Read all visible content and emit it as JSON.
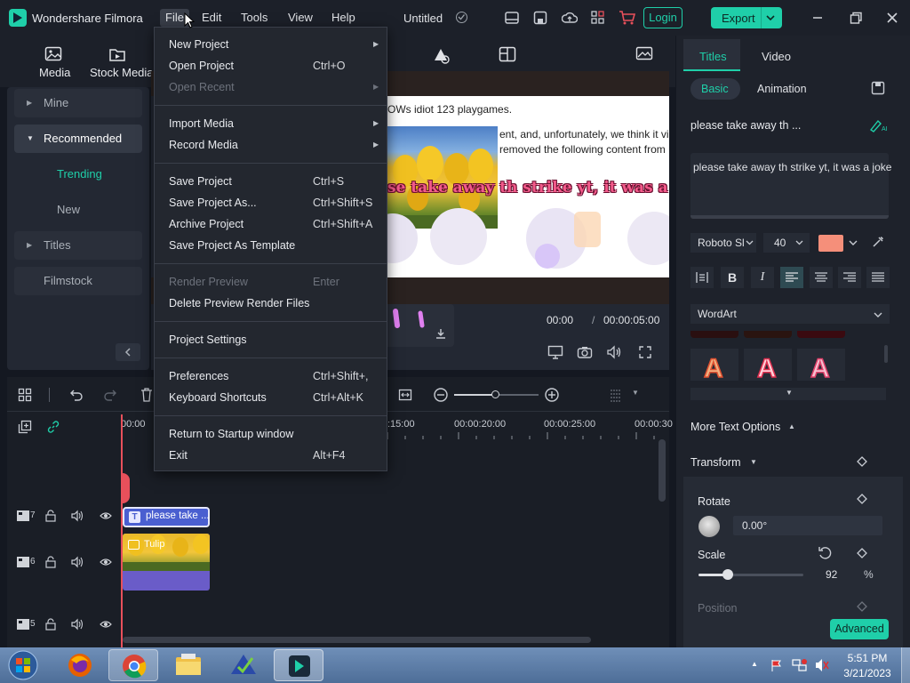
{
  "app": {
    "name": "Wondershare Filmora",
    "doc_title": "Untitled"
  },
  "menubar": [
    "File",
    "Edit",
    "Tools",
    "View",
    "Help"
  ],
  "header_actions": {
    "login": "Login",
    "export": "Export"
  },
  "toolbar": {
    "media": "Media",
    "stock_media": "Stock Media",
    "stickers_partial": "Stick",
    "templates_partial": "Templat"
  },
  "left_panel": {
    "items": [
      {
        "label": "Mine"
      },
      {
        "label": "Recommended"
      },
      {
        "label": "Trending"
      },
      {
        "label": "New"
      },
      {
        "label": "Titles"
      },
      {
        "label": "Filmstock"
      }
    ]
  },
  "file_menu": {
    "new_project": "New Project",
    "open_project": {
      "label": "Open Project",
      "shortcut": "Ctrl+O"
    },
    "open_recent": "Open Recent",
    "import_media": "Import Media",
    "record_media": "Record Media",
    "save_project": {
      "label": "Save Project",
      "shortcut": "Ctrl+S"
    },
    "save_project_as": {
      "label": "Save Project As...",
      "shortcut": "Ctrl+Shift+S"
    },
    "archive_project": {
      "label": "Archive Project",
      "shortcut": "Ctrl+Shift+A"
    },
    "save_template": "Save Project As Template",
    "render_preview": {
      "label": "Render Preview",
      "shortcut": "Enter"
    },
    "delete_render": "Delete Preview Render Files",
    "project_settings": "Project Settings",
    "preferences": {
      "label": "Preferences",
      "shortcut": "Ctrl+Shift+,"
    },
    "keyboard_shortcuts": {
      "label": "Keyboard Shortcuts",
      "shortcut": "Ctrl+Alt+K"
    },
    "return_startup": "Return to Startup window",
    "exit": {
      "label": "Exit",
      "shortcut": "Alt+F4"
    }
  },
  "preview": {
    "line1": "OWs idiot 123 playgames.",
    "line2": "ent, and, unfortunately, we think it viola",
    "line3": "removed the following content from",
    "caption": "se take away th strike yt, it was a joke",
    "current_time": "00:00",
    "separator": "/",
    "duration": "00:00:05:00"
  },
  "timeline": {
    "ruler": [
      "00:00",
      ":15:00",
      "00:00:20:00",
      "00:00:25:00",
      "00:00:30"
    ],
    "tracks": [
      {
        "num": "7"
      },
      {
        "num": "6"
      },
      {
        "num": "5"
      }
    ],
    "title_clip": "please take ...",
    "image_clip": "Tulip"
  },
  "right_panel": {
    "tabs": [
      "Titles",
      "Video"
    ],
    "subtabs": [
      "Basic",
      "Animation"
    ],
    "clip_name": "please take away th ...",
    "text_content": "please take away th strike yt, it was a joke",
    "font": "Roboto Sl",
    "size": "40",
    "wordart": "WordArt",
    "more_text_options": "More Text Options",
    "transform": "Transform",
    "rotate_label": "Rotate",
    "rotate_value": "0.00°",
    "scale_label": "Scale",
    "scale_value": "92",
    "scale_unit": "%",
    "scale_level": 0.28,
    "position_label": "Position",
    "advanced": "Advanced",
    "text_color": "#f58f7a"
  },
  "taskbar": {
    "time": "5:51 PM",
    "date": "3/21/2023"
  },
  "colors": {
    "accent": "#1fcfa9",
    "login": "#1fcfa9",
    "playhead": "#e8505b",
    "clip_title": "#4a5fd0"
  }
}
